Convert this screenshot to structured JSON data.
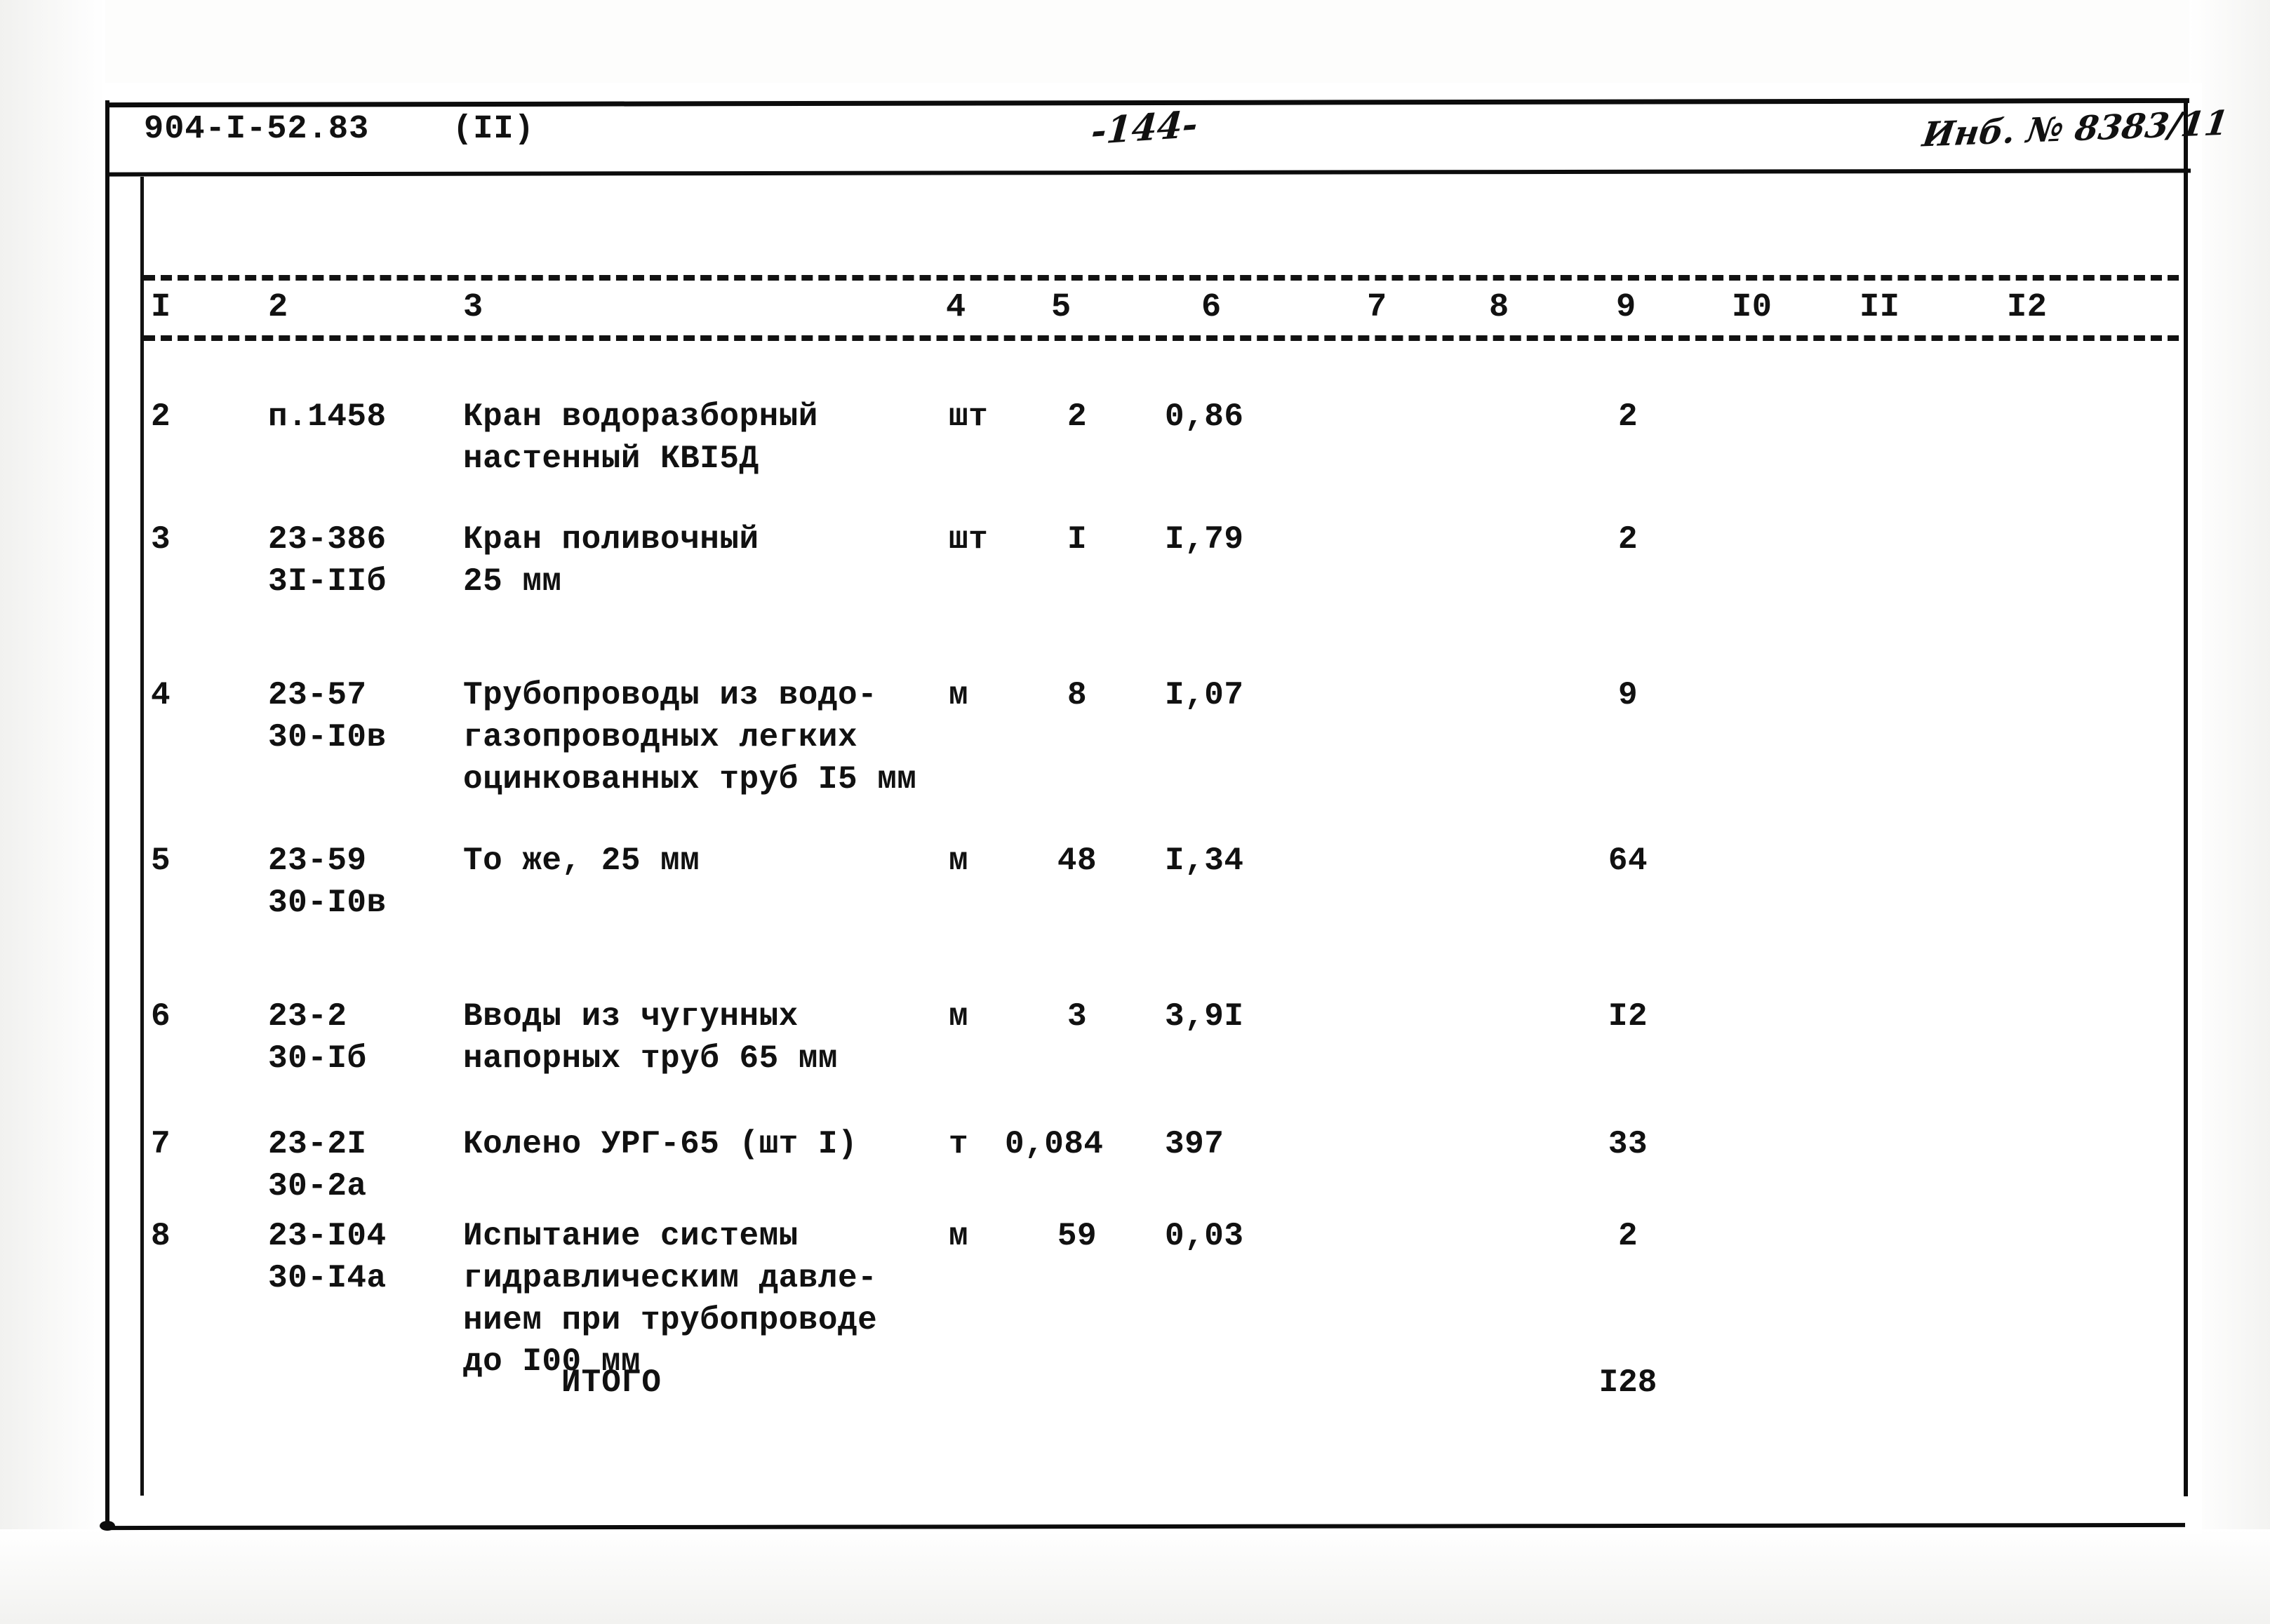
{
  "header": {
    "doc_code": "904-I-52.83",
    "doc_variant": "(II)",
    "page_number": "-144-",
    "inventory_stamp": "Инб. № 8383/11"
  },
  "table": {
    "column_numbers": [
      "I",
      "2",
      "3",
      "4",
      "5",
      "6",
      "7",
      "8",
      "9",
      "I0",
      "II",
      "I2"
    ],
    "rows": [
      {
        "num": "2",
        "code": "п.1458",
        "description": "Кран водоразборный\nнастенный КВI5Д",
        "unit": "шт",
        "qty": "2",
        "price": "0,86",
        "col7": "",
        "col8": "",
        "col9": "2",
        "col10": "",
        "col11": "",
        "col12": ""
      },
      {
        "num": "3",
        "code": "23-386\n3I-IIб",
        "description": "Кран поливочный\n25 мм",
        "unit": "шт",
        "qty": "I",
        "price": "I,79",
        "col7": "",
        "col8": "",
        "col9": "2",
        "col10": "",
        "col11": "",
        "col12": ""
      },
      {
        "num": "4",
        "code": "23-57\n30-I0в",
        "description": "Трубопроводы из водо-\nгазопроводных легких\nоцинкованных труб I5 мм",
        "unit": "м",
        "qty": "8",
        "price": "I,07",
        "col7": "",
        "col8": "",
        "col9": "9",
        "col10": "",
        "col11": "",
        "col12": ""
      },
      {
        "num": "5",
        "code": "23-59\n30-I0в",
        "description": "То же, 25 мм",
        "unit": "м",
        "qty": "48",
        "price": "I,34",
        "col7": "",
        "col8": "",
        "col9": "64",
        "col10": "",
        "col11": "",
        "col12": ""
      },
      {
        "num": "6",
        "code": "23-2\n30-Iб",
        "description": "Вводы из чугунных\nнапорных труб 65 мм",
        "unit": "м",
        "qty": "3",
        "price": "3,9I",
        "col7": "",
        "col8": "",
        "col9": "I2",
        "col10": "",
        "col11": "",
        "col12": ""
      },
      {
        "num": "7",
        "code": "23-2I\n30-2а",
        "description": "Колено УРГ-65 (шт I)",
        "unit": "т",
        "qty": "0,084",
        "price": "397",
        "col7": "",
        "col8": "",
        "col9": "33",
        "col10": "",
        "col11": "",
        "col12": ""
      },
      {
        "num": "8",
        "code": "23-I04\n30-I4а",
        "description": "Испытание системы\nгидравлическим давле-\nнием при трубопроводе\nдо I00 мм",
        "unit": "м",
        "qty": "59",
        "price": "0,03",
        "col7": "",
        "col8": "",
        "col9": "2",
        "col10": "",
        "col11": "",
        "col12": ""
      }
    ],
    "total": {
      "label": "ИТОГО",
      "value": "I28"
    }
  }
}
